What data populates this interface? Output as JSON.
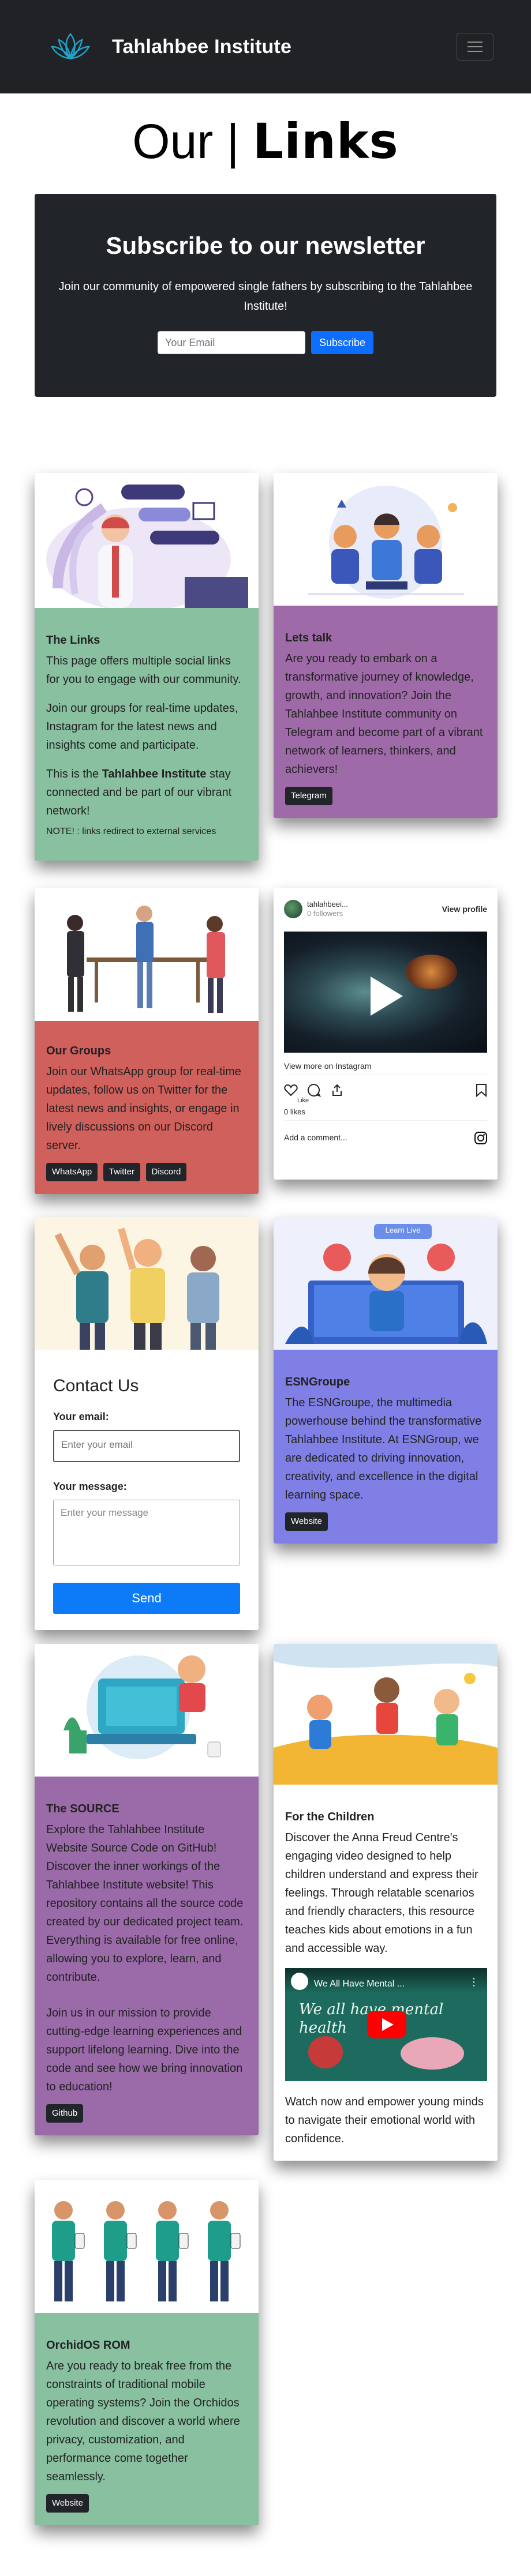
{
  "nav": {
    "brand": "Tahlahbee Institute"
  },
  "title": {
    "part1": "Our",
    "separator": "|",
    "part2": "Links"
  },
  "newsletter": {
    "heading": "Subscribe to our newsletter",
    "text": "Join our community of empowered single fathers by subscribing to the Tahlahbee Institute!",
    "email_placeholder": "Your Email",
    "button": "Subscribe"
  },
  "links_card": {
    "title": "The Links",
    "p1": "This page offers multiple social links for you to engage with our community.",
    "p2": "Join our groups for real-time updates, Instagram for the latest news and insights come and participate.",
    "p3_before": "This is the ",
    "p3_bold": "Tahlahbee Institute",
    "p3_after": " stay connected and be part of our vibrant network!",
    "note": "NOTE! : links redirect to external services"
  },
  "letstalk_card": {
    "title": "Lets talk",
    "text": "Are you ready to embark on a transformative journey of knowledge, growth, and innovation? Join the Tahlahbee Institute community on Telegram and become part of a vibrant network of learners, thinkers, and achievers!",
    "button": "Telegram"
  },
  "groups_card": {
    "title": "Our Groups",
    "text": "Join our WhatsApp group for real-time updates, follow us on Twitter for the latest news and insights, or engage in lively discussions on our Discord server.",
    "buttons": [
      "WhatsApp",
      "Twitter",
      "Discord"
    ]
  },
  "instagram": {
    "username": "tahlahbeei...",
    "followers": "0 followers",
    "view_profile": "View profile",
    "view_more": "View more on Instagram",
    "like": "Like",
    "likes": "0 likes",
    "add_comment": "Add a comment..."
  },
  "contact": {
    "heading": "Contact Us",
    "email_label": "Your email:",
    "email_placeholder": "Enter your email",
    "message_label": "Your message:",
    "message_placeholder": "Enter your message",
    "send": "Send"
  },
  "esn_card": {
    "title": "ESNGroupe",
    "text": "The ESNGroupe, the multimedia powerhouse behind the transformative Tahlahbee Institute. At ESNGroup, we are dedicated to driving innovation, creativity, and excellence in the digital learning space.",
    "button": "Website",
    "img_label": "Learn Live"
  },
  "source_card": {
    "title": "The SOURCE",
    "p1": "Explore the Tahlahbee Institute Website Source Code on GitHub! Discover the inner workings of the Tahlahbee Institute website! This repository contains all the source code created by our dedicated project team. Everything is available for free online, allowing you to explore, learn, and contribute.",
    "p2": "Join us in our mission to provide cutting-edge learning experiences and support lifelong learning. Dive into the code and see how we bring innovation to education!",
    "button": "Github"
  },
  "children_card": {
    "title": "For the Children",
    "text": "Discover the Anna Freud Centre's engaging video designed to help children understand and express their feelings. Through relatable scenarios and friendly characters, this resource teaches kids about emotions in a fun and accessible way.",
    "video_title": "We All Have Mental ...",
    "video_overlay": "We all have mental health",
    "after": "Watch now and empower young minds to navigate their emotional world with confidence."
  },
  "orchid_card": {
    "title": "OrchidOS ROM",
    "text": "Are you ready to break free from the constraints of traditional mobile operating systems? Join the Orchidos revolution and discover a world where privacy, customization, and performance come together seamlessly.",
    "button": "Website"
  },
  "colors": {
    "navbar": "#202226",
    "green_card": "#88c0a0",
    "purple_card": "#9e6aa8",
    "red_card": "#d0605c",
    "blue_card": "#7f7fe6",
    "primary": "#0d6efd"
  }
}
